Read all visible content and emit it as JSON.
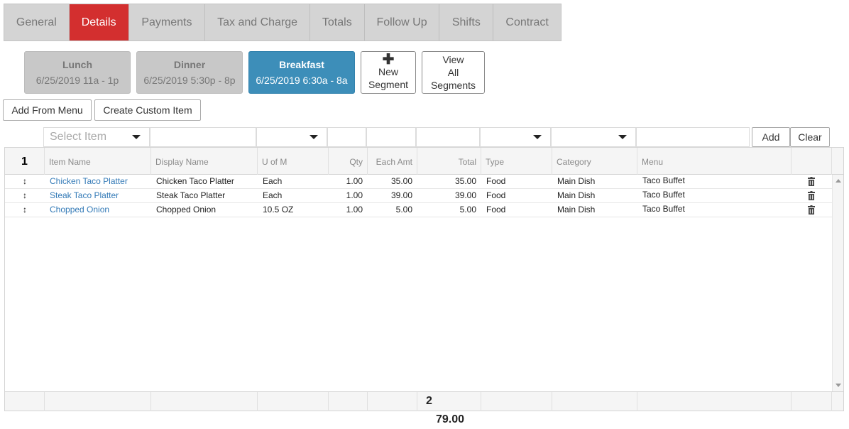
{
  "tabs": [
    "General",
    "Details",
    "Payments",
    "Tax and Charge",
    "Totals",
    "Follow Up",
    "Shifts",
    "Contract"
  ],
  "active_tab": "Details",
  "segments": [
    {
      "name": "Lunch",
      "date": "6/25/2019 11a - 1p"
    },
    {
      "name": "Dinner",
      "date": "6/25/2019 5:30p - 8p"
    },
    {
      "name": "Breakfast",
      "date": "6/25/2019 6:30a - 8a"
    }
  ],
  "new_segment": {
    "line1": "New",
    "line2": "Segment"
  },
  "view_all": {
    "line1": "View",
    "line2": "All",
    "line3": "Segments"
  },
  "actions": {
    "add_from_menu": "Add From Menu",
    "create_custom": "Create Custom Item"
  },
  "filter": {
    "select_placeholder": "Select Item",
    "add": "Add",
    "clear": "Clear"
  },
  "grid": {
    "group_count": "1",
    "columns": [
      "Item Name",
      "Display Name",
      "U of M",
      "Qty",
      "Each Amt",
      "Total",
      "Type",
      "Category",
      "Menu"
    ],
    "rows": [
      {
        "item": "Chicken Taco Platter",
        "display": "Chicken Taco Platter",
        "uom": "Each",
        "qty": "1.00",
        "each": "35.00",
        "total": "35.00",
        "type": "Food",
        "category": "Main Dish",
        "menu": "Taco Buffet"
      },
      {
        "item": "Steak Taco Platter",
        "display": "Steak Taco Platter",
        "uom": "Each",
        "qty": "1.00",
        "each": "39.00",
        "total": "39.00",
        "type": "Food",
        "category": "Main Dish",
        "menu": "Taco Buffet"
      },
      {
        "item": "Chopped Onion",
        "display": "Chopped Onion",
        "uom": "10.5 OZ",
        "qty": "1.00",
        "each": "5.00",
        "total": "5.00",
        "type": "Food",
        "category": "Main Dish",
        "menu": "Taco Buffet"
      }
    ],
    "footer": {
      "count": "2",
      "total": "79.00"
    }
  },
  "colors": {
    "active_tab": "#d32f2f",
    "active_segment": "#3d8eb9",
    "link": "#337ab7"
  }
}
